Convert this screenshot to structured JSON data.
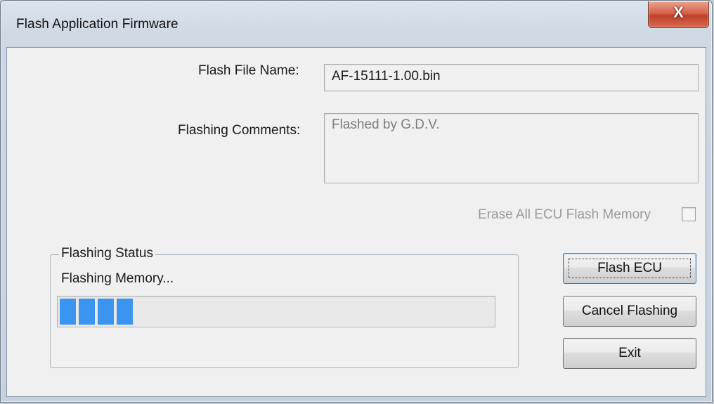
{
  "window": {
    "title": "Flash Application Firmware",
    "close_glyph": "X"
  },
  "form": {
    "file_name_label": "Flash File Name:",
    "file_name_value": "AF-15111-1.00.bin",
    "comments_label": "Flashing Comments:",
    "comments_value": "Flashed by G.D.V.",
    "erase_label": "Erase All ECU Flash Memory",
    "erase_checked": false
  },
  "status": {
    "group_label": "Flashing Status",
    "message": "Flashing Memory...",
    "progress_blocks": 4,
    "progress_color": "#3b95f0"
  },
  "buttons": {
    "flash_label": "Flash ECU",
    "cancel_label": "Cancel Flashing",
    "exit_label": "Exit"
  }
}
